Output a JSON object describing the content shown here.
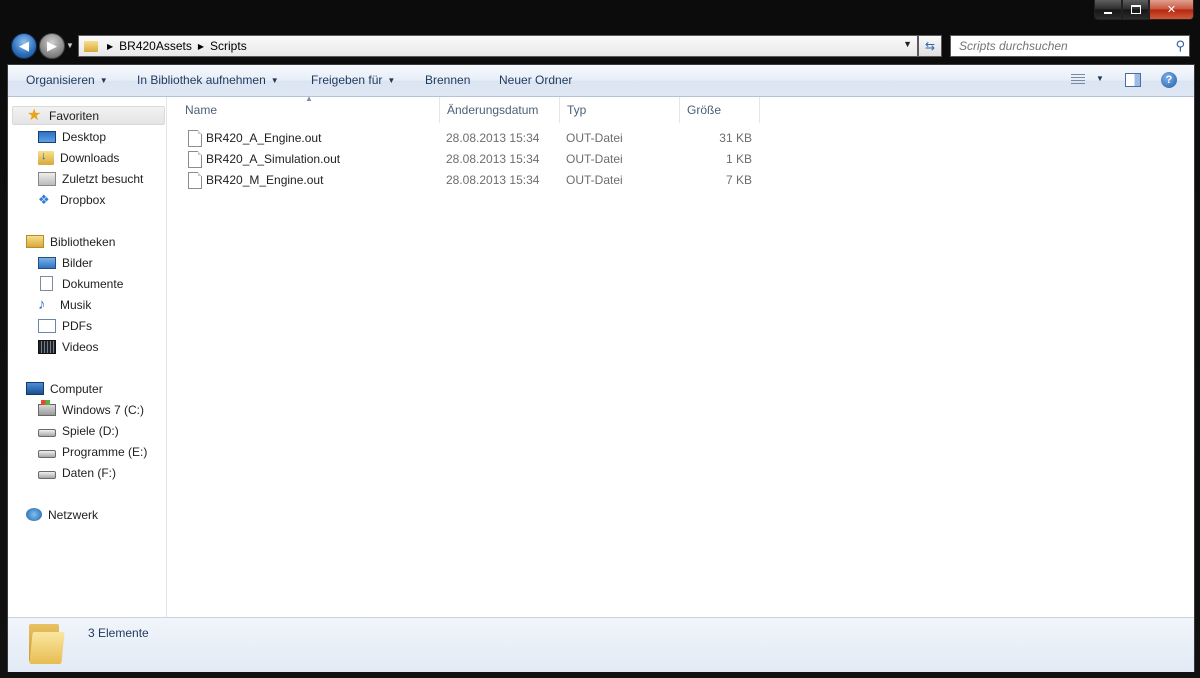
{
  "window": {
    "caption_buttons": {
      "minimize": "minimize",
      "maximize": "maximize",
      "close": "close"
    }
  },
  "address": {
    "breadcrumbs": [
      "BR420Assets",
      "Scripts"
    ],
    "search_placeholder": "Scripts durchsuchen"
  },
  "toolbar": {
    "organize": "Organisieren",
    "include_library": "In Bibliothek aufnehmen",
    "share": "Freigeben für",
    "burn": "Brennen",
    "new_folder": "Neuer Ordner"
  },
  "nav": {
    "favorites": {
      "label": "Favoriten",
      "items": [
        "Desktop",
        "Downloads",
        "Zuletzt besucht",
        "Dropbox"
      ]
    },
    "libraries": {
      "label": "Bibliotheken",
      "items": [
        "Bilder",
        "Dokumente",
        "Musik",
        "PDFs",
        "Videos"
      ]
    },
    "computer": {
      "label": "Computer",
      "items": [
        "Windows 7 (C:)",
        "Spiele (D:)",
        "Programme (E:)",
        "Daten (F:)"
      ]
    },
    "network": {
      "label": "Netzwerk"
    }
  },
  "columns": {
    "name": "Name",
    "date": "Änderungsdatum",
    "type": "Typ",
    "size": "Größe"
  },
  "files": [
    {
      "name": "BR420_A_Engine.out",
      "date": "28.08.2013 15:34",
      "type": "OUT-Datei",
      "size": "31 KB"
    },
    {
      "name": "BR420_A_Simulation.out",
      "date": "28.08.2013 15:34",
      "type": "OUT-Datei",
      "size": "1 KB"
    },
    {
      "name": "BR420_M_Engine.out",
      "date": "28.08.2013 15:34",
      "type": "OUT-Datei",
      "size": "7 KB"
    }
  ],
  "status": {
    "item_count": "3 Elemente"
  }
}
